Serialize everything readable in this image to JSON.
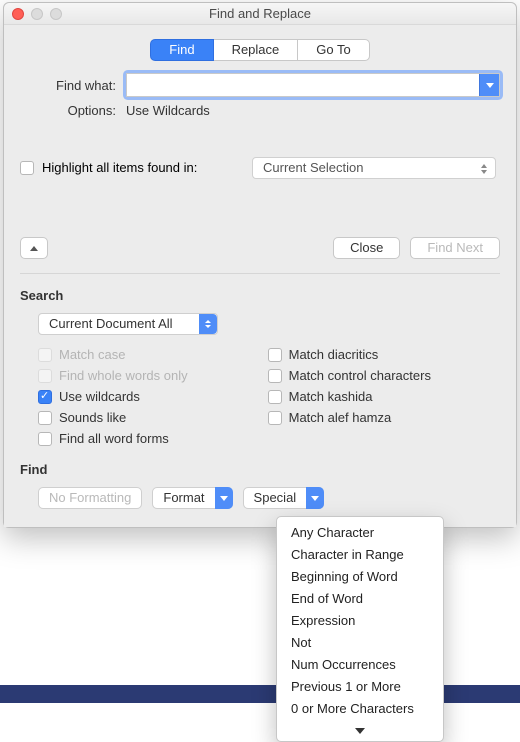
{
  "window": {
    "title": "Find and Replace"
  },
  "tabs": {
    "find": "Find",
    "replace": "Replace",
    "goto": "Go To"
  },
  "findwhat": {
    "label": "Find what:",
    "value": ""
  },
  "options": {
    "label": "Options:",
    "value": "Use Wildcards"
  },
  "highlight": {
    "label": "Highlight all items found in:",
    "select": "Current Selection"
  },
  "buttons": {
    "close": "Close",
    "findnext": "Find Next"
  },
  "search": {
    "heading": "Search",
    "scope": "Current Document All",
    "left": {
      "matchcase": "Match case",
      "whole": "Find whole words only",
      "wild": "Use wildcards",
      "sounds": "Sounds like",
      "forms": "Find all word forms"
    },
    "right": {
      "diac": "Match diacritics",
      "ctrl": "Match control characters",
      "kash": "Match kashida",
      "alef": "Match alef hamza"
    }
  },
  "find": {
    "heading": "Find",
    "noformat": "No Formatting",
    "format": "Format",
    "special": "Special"
  },
  "menu": {
    "items": [
      "Any Character",
      "Character in Range",
      "Beginning of Word",
      "End of Word",
      "Expression",
      "Not",
      "Num Occurrences",
      "Previous 1 or More",
      "0 or More Characters"
    ]
  }
}
